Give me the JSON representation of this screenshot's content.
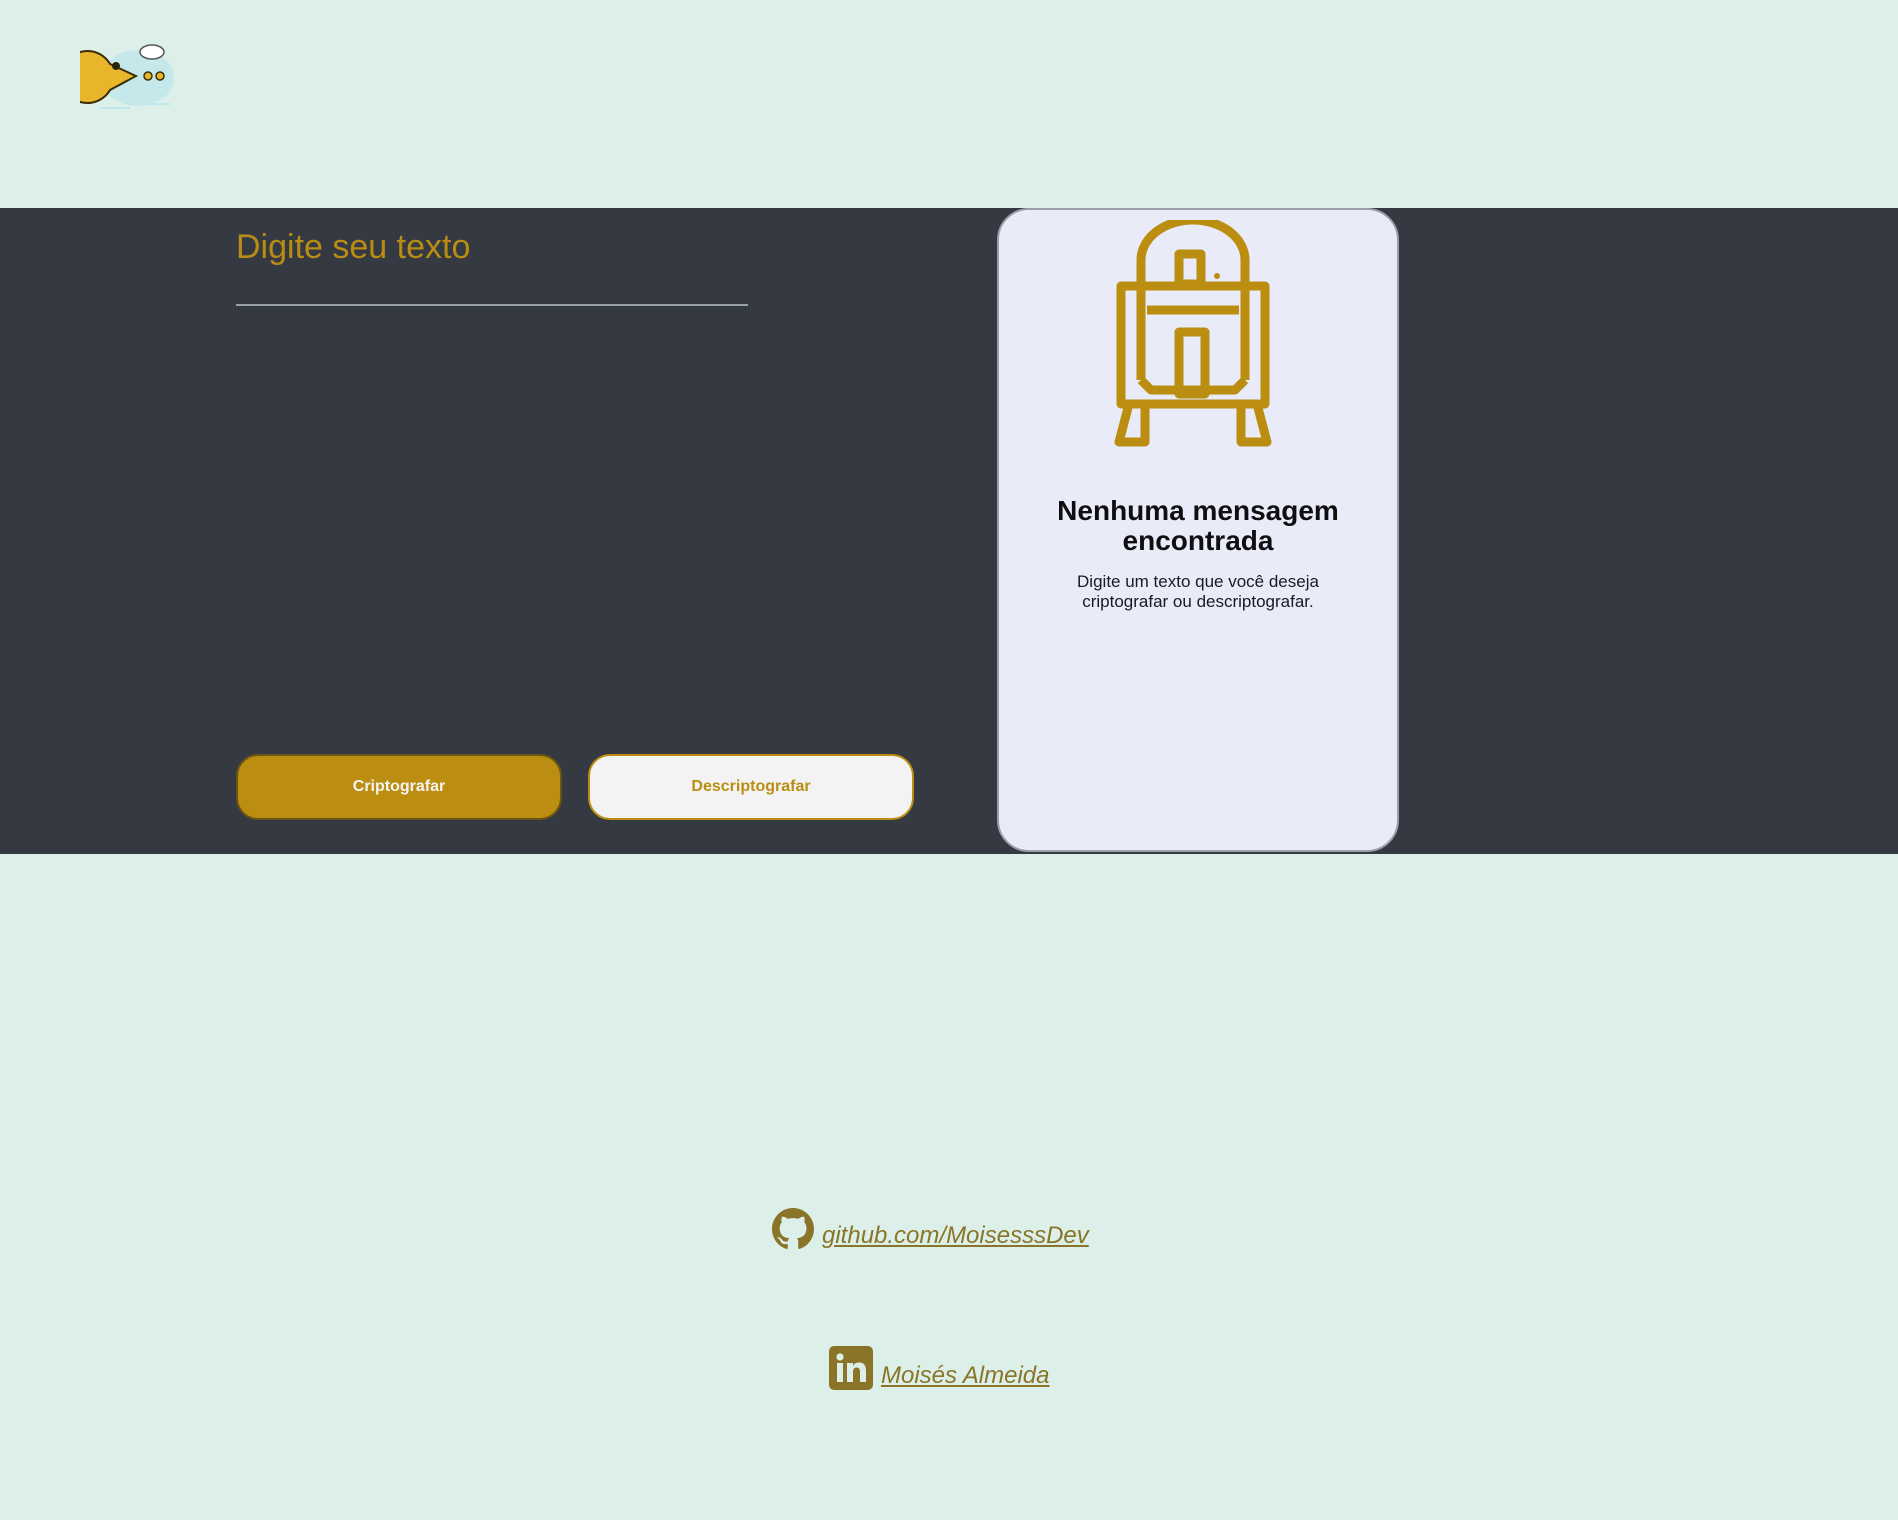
{
  "header": {
    "logo_icon": "pacman-clouds-logo"
  },
  "encrypter": {
    "placeholder": "Digite seu texto",
    "encrypt_label": "Criptografar",
    "decrypt_label": "Descriptografar"
  },
  "output": {
    "illustration_icon": "robot-icon",
    "title": "Nenhuma mensagem encontrada",
    "text": "Digite um texto que você deseja criptografar ou descriptografar."
  },
  "footer": {
    "github": {
      "icon": "github-icon",
      "label": "github.com/MoisesssDev"
    },
    "linkedin": {
      "icon": "linkedin-icon",
      "label": "Moisés Almeida"
    }
  },
  "colors": {
    "background": "#dcf0e9",
    "main_panel": "#353a42",
    "accent": "#bb8e12",
    "card": "#eaebf8",
    "link": "#8a7428"
  }
}
